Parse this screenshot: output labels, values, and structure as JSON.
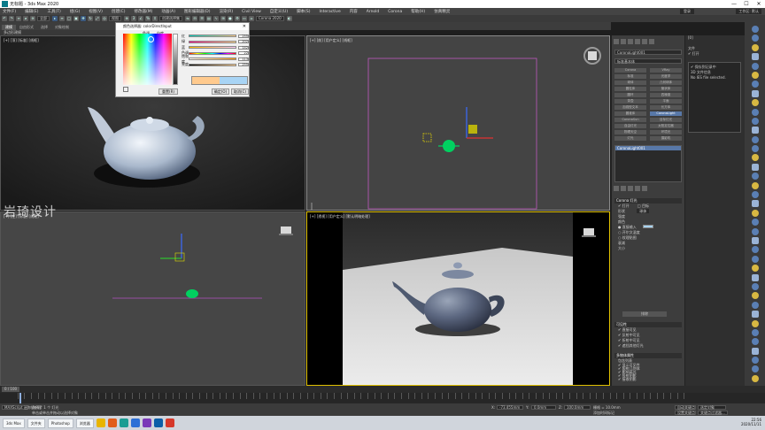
{
  "window": {
    "title": "无标题 - 3ds Max 2020",
    "minimize": "—",
    "maximize": "☐",
    "close": "✕"
  },
  "menubar": {
    "items": [
      "文件(F)",
      "编辑(E)",
      "工具(T)",
      "组(G)",
      "视图(V)",
      "创建(C)",
      "修改器(M)",
      "动画(A)",
      "图形编辑器(D)",
      "渲染(R)",
      "Civil View",
      "自定义(U)",
      "脚本(S)",
      "Interactive",
      "内容",
      "Arnold",
      "Corona",
      "帮助(H)",
      "仿真精灵"
    ],
    "user": "登录",
    "workspace": "工作区: 默认"
  },
  "toolbar": {
    "filter": "全部",
    "view": "视图",
    "selection_set": "创建选择集",
    "render_preset": "Corona 2020"
  },
  "ribbon": {
    "tabs": [
      "建模",
      "自由形式",
      "选择",
      "对象绘制"
    ],
    "sub_label": "多边形建模"
  },
  "viewports": {
    "top_label": "[+] [顶] [标准] [线框]",
    "front_label": "[+] [前] [用户定义] [线框]",
    "left_label": "[+] [左] [标准] [线框]",
    "persp_label": "[+] [透视] [用户定义] [默认明暗处理]"
  },
  "watermark": "岩琦设计",
  "color_dialog": {
    "title": "颜色选择器: colorDirectInput",
    "tab_hue": "色调",
    "tab_white": "白度",
    "rows": [
      {
        "label": "红",
        "value": "255"
      },
      {
        "label": "绿",
        "value": "202"
      },
      {
        "label": "蓝",
        "value": "142"
      },
      {
        "label": "色调",
        "value": "22"
      },
      {
        "label": "饱和度",
        "value": "113"
      },
      {
        "label": "亮度",
        "value": "255"
      }
    ],
    "reset": "重置(R)",
    "ok": "确定(O)",
    "cancel": "取消(C)",
    "color_old": "#ffca8e",
    "color_new": "#a8d4f5"
  },
  "command_panel": {
    "object_name": "CoronaLight001",
    "category": "标准基本体",
    "grid_buttons": [
      "Corona",
      "VRay",
      "标准",
      "光度学",
      "球体",
      "几何球体",
      "圆柱体",
      "管状体",
      "圆环",
      "四棱锥",
      "茶壶",
      "平面",
      "加强型文本",
      "长方体",
      "圆锥体",
      "CoronaLight",
      "CoronaSun",
      "目标灯光",
      "自由灯光",
      "太阳定位器",
      "物理天空",
      "环境光",
      "灯光",
      "摄影机"
    ],
    "list_selected": "CoronaLight001",
    "main_section": "Corona 灯光",
    "on_label": "✔ 打开",
    "targeted_label": "□ 目标",
    "shape_label": "形状",
    "shape_value": "球体",
    "intensity_label": "强度",
    "color_label": "颜色",
    "direct_input": "● 直接输入",
    "kelvin": "○ 开尔文温度",
    "texmap": "○ 纹理贴图",
    "falloff_label": "衰减",
    "size_label": "大小",
    "exclude_button": "排除",
    "visibility_section": "可见性",
    "visible_direct": "✔ 直接可见",
    "visible_reflect": "✔ 反射中可见",
    "visible_refract": "✔ 折射中可见",
    "occlude": "✔ 遮挡其他灯光",
    "object_props": "多物体属性",
    "include_list": "包含列表",
    "props": [
      "✔ 显示可见性",
      "✔ 照射几何体",
      "✔ 影响高光",
      "✔ 投射阴影",
      "✔ 接收阴影",
      "✔ 透明度"
    ]
  },
  "far_right": {
    "header": "[0]",
    "file": "文件",
    "open": "✔ 打开",
    "save": "✔ 保存到记录中",
    "info": "3D 文件信息",
    "status": "No IES file selected."
  },
  "timeline": {
    "frame": "0 / 100"
  },
  "statusbar": {
    "selection": "选择了 1 个 灯光",
    "maxscript": "MAXScript 迷你侦听器",
    "hint": "单击或单击并拖动以选择对象",
    "x_label": "X:",
    "x_value": "-73.455mm",
    "y_label": "Y:",
    "y_value": "0.0mm",
    "z_label": "Z:",
    "z_value": "100.0mm",
    "grid": "栅格 = 10.0mm",
    "add_time": "添加时间标记",
    "autokey": "自动关键点",
    "setkey": "设置关键点",
    "selected": "选定对象",
    "filters": "关键点过滤器..."
  },
  "taskbar": {
    "items": [
      "3ds Max",
      "文件夹",
      "Photoshop",
      "浏览器"
    ],
    "time": "22:56",
    "date": "2020/11/11"
  }
}
